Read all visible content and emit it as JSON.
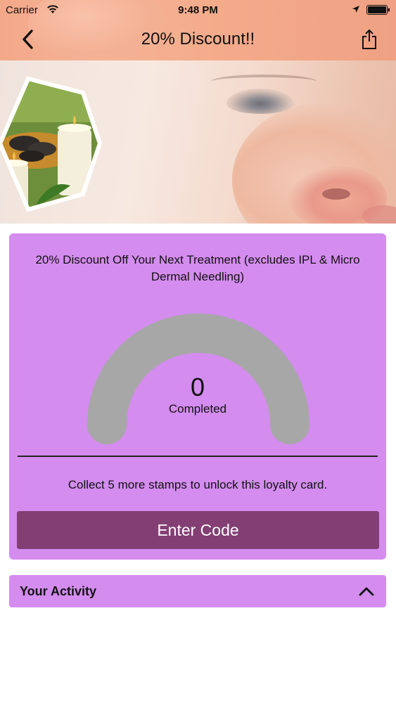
{
  "status_bar": {
    "carrier": "Carrier",
    "time": "9:48 PM",
    "icons": [
      "wifi-icon",
      "location-arrow-icon",
      "battery-icon"
    ]
  },
  "nav": {
    "title": "20% Discount!!",
    "back_icon": "chevron-left-icon",
    "share_icon": "share-icon"
  },
  "hero": {
    "image": "spa-banner-photo"
  },
  "loyalty_card": {
    "description": "20% Discount Off Your Next Treatment (excludes IPL & Micro Dermal Needling)",
    "completed_count": "0",
    "completed_label": "Completed",
    "progress_fraction": 0,
    "message": "Collect 5 more stamps to unlock this loyalty card.",
    "button_label": "Enter Code"
  },
  "activity": {
    "label": "Your Activity",
    "toggle_icon": "chevron-up-icon"
  },
  "colors": {
    "card_bg": "#d48cef",
    "button_bg": "#833f74",
    "gauge_track": "#a7a7a7",
    "header_bg": "#f3a889"
  }
}
